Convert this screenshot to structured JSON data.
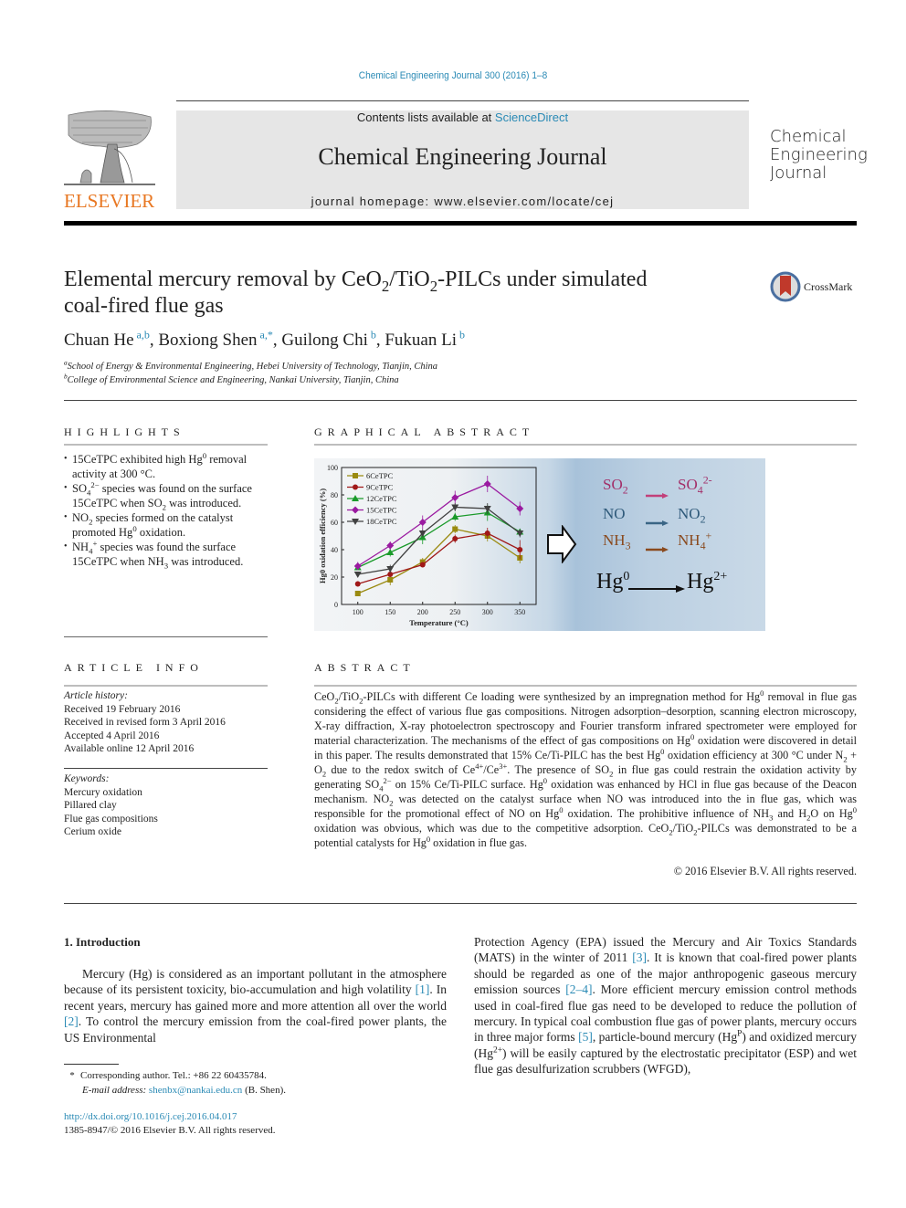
{
  "header": {
    "citation": "Chemical Engineering Journal 300 (2016) 1–8",
    "contents_prefix": "Contents lists available at ",
    "contents_link": "ScienceDirect",
    "journal_name": "Chemical Engineering Journal",
    "homepage": "journal homepage: www.elsevier.com/locate/cej",
    "publisher_logo_text": "ELSEVIER",
    "journal_logo_lines": [
      "Chemical",
      "Engineering",
      "Journal"
    ],
    "colors": {
      "link": "#2a8ab5",
      "elsevier_orange": "#e87722"
    }
  },
  "article": {
    "title_line1_a": "Elemental mercury removal by CeO",
    "title_line1_b": "/TiO",
    "title_line1_c": "-PILCs under simulated",
    "title_sub": "2",
    "title_line2": "coal-fired flue gas",
    "crossmark_label": "CrossMark",
    "authors": [
      {
        "name": "Chuan He",
        "sup": "a,b",
        "sep": ", "
      },
      {
        "name": "Boxiong Shen",
        "sup": "a,*",
        "sep": ", "
      },
      {
        "name": "Guilong Chi",
        "sup": "b",
        "sep": ", "
      },
      {
        "name": "Fukuan Li",
        "sup": "b",
        "sep": ""
      }
    ],
    "affiliations": [
      {
        "mark": "a",
        "text": "School of Energy & Environmental Engineering, Hebei University of Technology, Tianjin, China"
      },
      {
        "mark": "b",
        "text": "College of Environmental Science and Engineering, Nankai University, Tianjin, China"
      }
    ]
  },
  "highlights": {
    "heading": "HIGHLIGHTS",
    "items_html": [
      "15CeTPC exhibited high Hg<sup>0</sup> removal activity at 300 °C.",
      "SO<sub>4</sub><sup>2−</sup> species was found on the surface 15CeTPC when SO<sub>2</sub> was introduced.",
      "NO<sub>2</sub> species formed on the catalyst promoted Hg<sup>0</sup> oxidation.",
      "NH<sub>4</sub><sup>+</sup> species was found the surface 15CeTPC when NH<sub>3</sub> was introduced."
    ]
  },
  "graphical_abstract": {
    "heading": "GRAPHICAL ABSTRACT",
    "reactions": [
      {
        "from": "SO2",
        "to": "SO4 2-",
        "color": "#a3306a"
      },
      {
        "from": "NO",
        "to": "NO2",
        "color": "#2f5a7a"
      },
      {
        "from": "NH3",
        "to": "NH4 +",
        "color": "#8a4a1e"
      }
    ],
    "main_reaction": {
      "from": "Hg0",
      "to": "Hg2+"
    }
  },
  "chart_data": {
    "type": "line",
    "title": "",
    "xlabel": "Temperature (°C)",
    "ylabel": "Hg0 oxidation efficiency (%)",
    "x": [
      100,
      150,
      200,
      250,
      300,
      350
    ],
    "xlim": [
      75,
      375
    ],
    "ylim": [
      0,
      100
    ],
    "xticks": [
      100,
      150,
      200,
      250,
      300,
      350
    ],
    "yticks": [
      0,
      20,
      40,
      60,
      80,
      100
    ],
    "legend_position": "top-left",
    "grid": false,
    "series": [
      {
        "name": "6CeTPC",
        "marker": "square",
        "color": "#9a8a10",
        "values": [
          8,
          18,
          31,
          55,
          50,
          34
        ],
        "errors": [
          2,
          4,
          3,
          3,
          4,
          4
        ]
      },
      {
        "name": "9CeTPC",
        "marker": "circle",
        "color": "#a01818",
        "values": [
          15,
          22,
          29,
          48,
          52,
          40
        ],
        "errors": [
          2,
          2,
          2,
          3,
          4,
          7
        ]
      },
      {
        "name": "12CeTPC",
        "marker": "triangle",
        "color": "#1a9a2a",
        "values": [
          27,
          38,
          49,
          64,
          67,
          53
        ],
        "errors": [
          2,
          3,
          5,
          3,
          6,
          2
        ]
      },
      {
        "name": "15CeTPC",
        "marker": "diamond",
        "color": "#9a1aa0",
        "values": [
          28,
          43,
          60,
          78,
          88,
          70
        ],
        "errors": [
          3,
          3,
          5,
          5,
          6,
          5
        ]
      },
      {
        "name": "18CeTPC",
        "marker": "triangle-down",
        "color": "#404040",
        "values": [
          22,
          26,
          52,
          71,
          70,
          52
        ],
        "errors": [
          2,
          3,
          3,
          3,
          4,
          3
        ]
      }
    ]
  },
  "article_info": {
    "heading": "ARTICLE INFO",
    "history_label": "Article history:",
    "history": [
      "Received 19 February 2016",
      "Received in revised form 3 April 2016",
      "Accepted 4 April 2016",
      "Available online 12 April 2016"
    ],
    "keywords_label": "Keywords:",
    "keywords": [
      "Mercury oxidation",
      "Pillared clay",
      "Flue gas compositions",
      "Cerium oxide"
    ]
  },
  "abstract": {
    "heading": "ABSTRACT",
    "body_html": "CeO<sub>2</sub>/TiO<sub>2</sub>-PILCs with different Ce loading were synthesized by an impregnation method for Hg<sup>0</sup> removal in flue gas considering the effect of various flue gas compositions. Nitrogen adsorption–desorption, scanning electron microscopy, X-ray diffraction, X-ray photoelectron spectroscopy and Fourier transform infrared spectrometer were employed for material characterization. The mechanisms of the effect of gas compositions on Hg<sup>0</sup> oxidation were discovered in detail in this paper. The results demonstrated that 15% Ce/Ti-PILC has the best Hg<sup>0</sup> oxidation efficiency at 300 °C under N<sub>2</sub> + O<sub>2</sub> due to the redox switch of Ce<sup>4+</sup>/Ce<sup>3+</sup>. The presence of SO<sub>2</sub> in flue gas could restrain the oxidation activity by generating SO<sub>4</sub><sup>2−</sup> on 15% Ce/Ti-PILC surface. Hg<sup>0</sup> oxidation was enhanced by HCl in flue gas because of the Deacon mechanism. NO<sub>2</sub> was detected on the catalyst surface when NO was introduced into the in flue gas, which was responsible for the promotional effect of NO on Hg<sup>0</sup> oxidation. The prohibitive influence of NH<sub>3</sub> and H<sub>2</sub>O on Hg<sup>0</sup> oxidation was obvious, which was due to the competitive adsorption. CeO<sub>2</sub>/TiO<sub>2</sub>-PILCs was demonstrated to be a potential catalysts for Hg<sup>0</sup> oxidation in flue gas.",
    "copyright": "© 2016 Elsevier B.V. All rights reserved."
  },
  "introduction": {
    "heading": "1. Introduction",
    "col1_html": "Mercury (Hg) is considered as an important pollutant in the atmosphere because of its persistent toxicity, bio-accumulation and high volatility <span class=\"link\">[1]</span>. In recent years, mercury has gained more and more attention all over the world <span class=\"link\">[2]</span>. To control the mercury emission from the coal-fired power plants, the US Environmental",
    "col2_html": "Protection Agency (EPA) issued the Mercury and Air Toxics Standards (MATS) in the winter of 2011 <span class=\"link\">[3]</span>. It is known that coal-fired power plants should be regarded as one of the major anthropogenic gaseous mercury emission sources <span class=\"link\">[2–4]</span>. More efficient mercury emission control methods used in coal-fired flue gas need to be developed to reduce the pollution of mercury. In typical coal combustion flue gas of power plants, mercury occurs in three major forms <span class=\"link\">[5]</span>, particle-bound mercury (Hg<sup>P</sup>) and oxidized mercury (Hg<sup>2+</sup>) will be easily captured by the electrostatic precipitator (ESP) and wet flue gas desulfurization scrubbers (WFGD),"
  },
  "footnotes": {
    "corresponding": "Corresponding author. Tel.: +86 22 60435784.",
    "email_label": "E-mail address: ",
    "email": "shenbx@nankai.edu.cn",
    "email_suffix": " (B. Shen).",
    "doi": "http://dx.doi.org/10.1016/j.cej.2016.04.017",
    "issn_line": "1385-8947/© 2016 Elsevier B.V. All rights reserved."
  }
}
